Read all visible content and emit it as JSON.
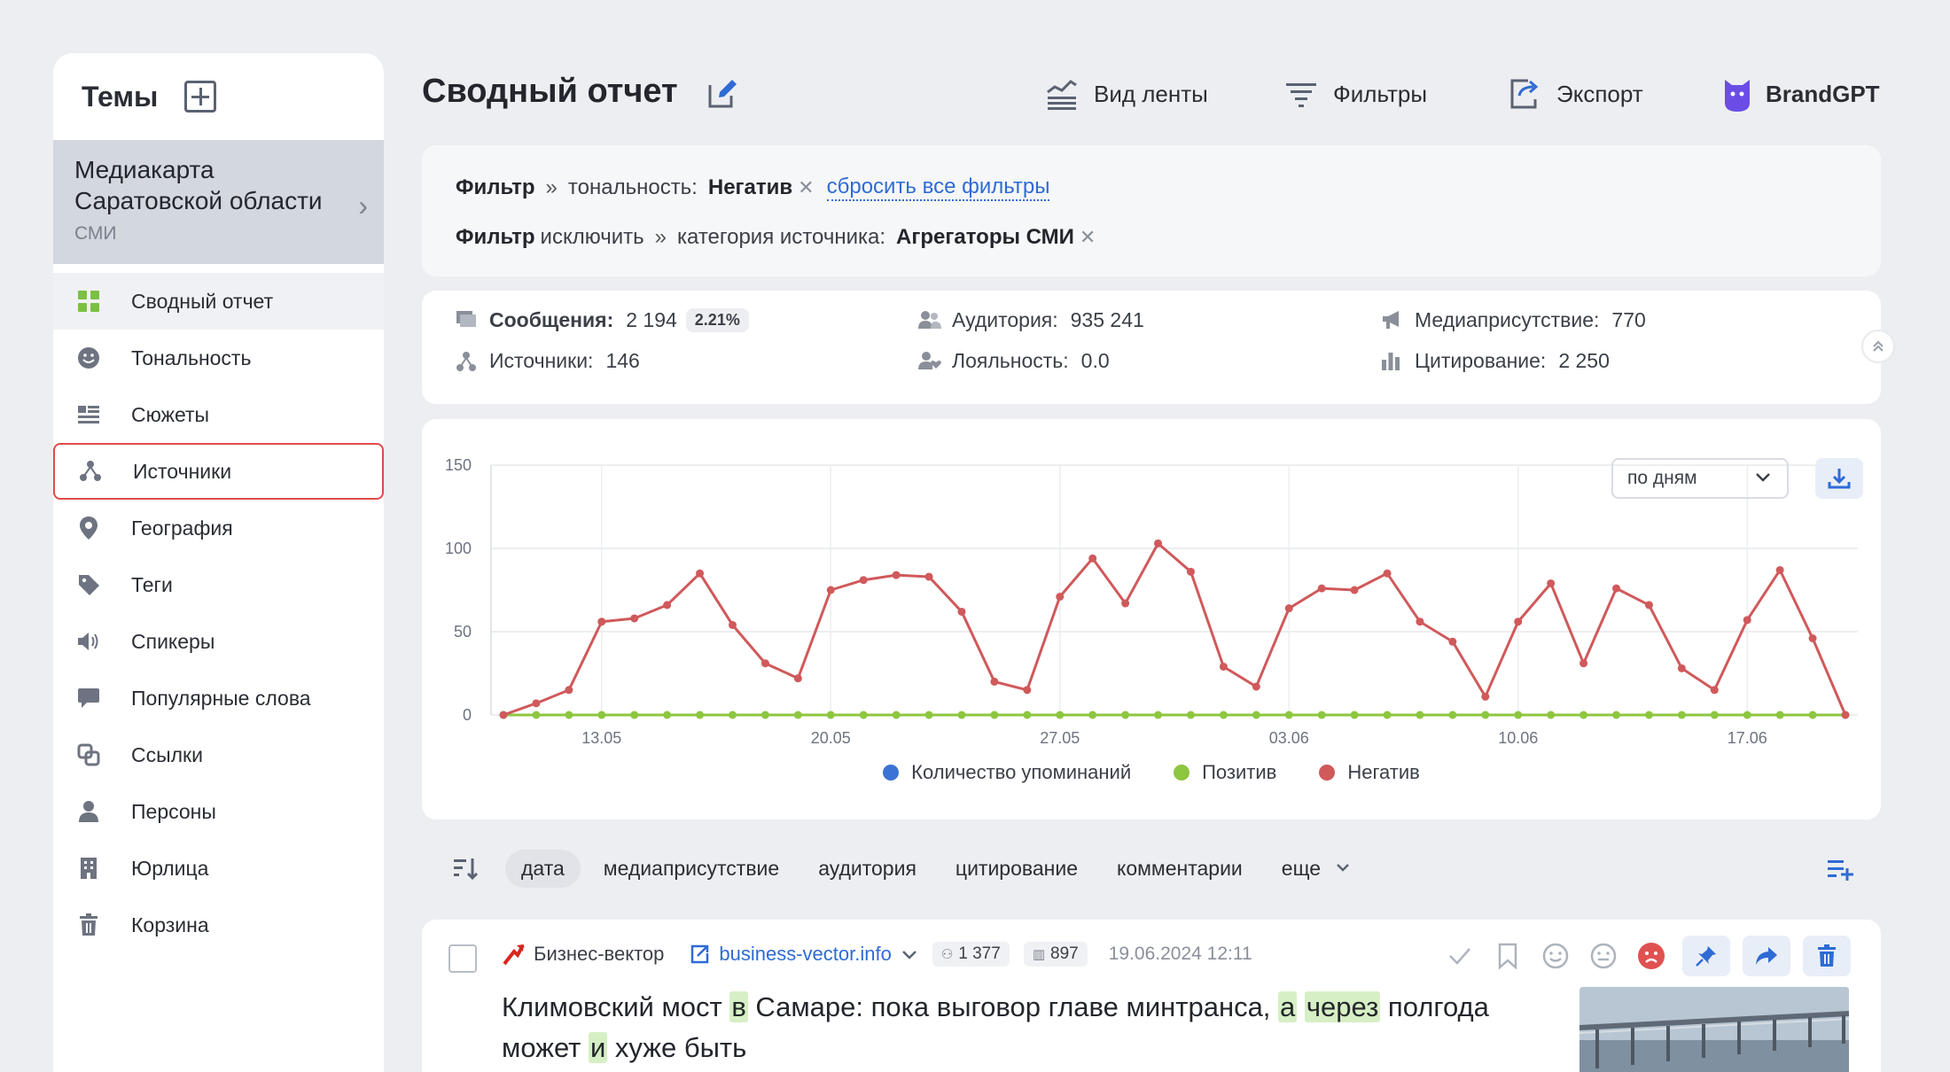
{
  "sidebar": {
    "header_title": "Темы",
    "project": {
      "name": "Медиакарта Саратовской области",
      "type": "СМИ"
    },
    "items": [
      {
        "label": "Сводный отчет",
        "icon": "grid-icon"
      },
      {
        "label": "Тональность",
        "icon": "smile-icon"
      },
      {
        "label": "Сюжеты",
        "icon": "news-icon"
      },
      {
        "label": "Источники",
        "icon": "nodes-icon"
      },
      {
        "label": "География",
        "icon": "location-pin-icon"
      },
      {
        "label": "Теги",
        "icon": "tag-icon"
      },
      {
        "label": "Спикеры",
        "icon": "speaker-icon"
      },
      {
        "label": "Популярные слова",
        "icon": "chat-bubble-icon"
      },
      {
        "label": "Ссылки",
        "icon": "link-icon"
      },
      {
        "label": "Персоны",
        "icon": "person-icon"
      },
      {
        "label": "Юрлица",
        "icon": "building-icon"
      },
      {
        "label": "Корзина",
        "icon": "trash-icon"
      }
    ]
  },
  "header": {
    "title": "Сводный отчет",
    "toolbar": {
      "feed_view": "Вид ленты",
      "filters": "Фильтры",
      "export": "Экспорт",
      "brandgpt": "BrandGPT"
    }
  },
  "filters": {
    "line1": {
      "prefix": "Фильтр",
      "sep": "»",
      "key": "тональность:",
      "value": "Негатив",
      "reset": "сбросить все фильтры"
    },
    "line2": {
      "prefix": "Фильтр",
      "suffix": "исключить",
      "sep": "»",
      "key": "категория источника:",
      "value": "Агрегаторы СМИ"
    }
  },
  "stats": {
    "messages": {
      "label": "Сообщения:",
      "value": "2 194",
      "badge": "2.21%"
    },
    "sources": {
      "label": "Источники:",
      "value": "146"
    },
    "audience": {
      "label": "Аудитория:",
      "value": "935 241"
    },
    "loyalty": {
      "label": "Лояльность:",
      "value": "0.0"
    },
    "media_presence": {
      "label": "Медиаприсутствие:",
      "value": "770"
    },
    "citation": {
      "label": "Цитирование:",
      "value": "2 250"
    }
  },
  "chart_controls": {
    "period": "по дням"
  },
  "chart_data": {
    "type": "line",
    "x": [
      "10.05",
      "11.05",
      "12.05",
      "13.05",
      "14.05",
      "15.05",
      "16.05",
      "17.05",
      "18.05",
      "19.05",
      "20.05",
      "21.05",
      "22.05",
      "23.05",
      "24.05",
      "25.05",
      "26.05",
      "27.05",
      "28.05",
      "29.05",
      "30.05",
      "31.05",
      "01.06",
      "02.06",
      "03.06",
      "04.06",
      "05.06",
      "06.06",
      "07.06",
      "08.06",
      "09.06",
      "10.06",
      "11.06",
      "12.06",
      "13.06",
      "14.06",
      "15.06",
      "16.06",
      "17.06",
      "18.06",
      "19.06",
      "20.06"
    ],
    "xticks": [
      "13.05",
      "20.05",
      "27.05",
      "03.06",
      "10.06",
      "17.06"
    ],
    "ylim": [
      0,
      150
    ],
    "yticks": [
      0,
      50,
      100,
      150
    ],
    "series": [
      {
        "name": "Количество упоминаний",
        "color": "#3b72d6",
        "values": []
      },
      {
        "name": "Позитив",
        "color": "#8dc63f",
        "values": [
          0,
          0,
          0,
          0,
          0,
          0,
          0,
          0,
          0,
          0,
          0,
          0,
          0,
          0,
          0,
          0,
          0,
          0,
          0,
          0,
          0,
          0,
          0,
          0,
          0,
          0,
          0,
          0,
          0,
          0,
          0,
          0,
          0,
          0,
          0,
          0,
          0,
          0,
          0,
          0,
          0,
          0
        ]
      },
      {
        "name": "Негатив",
        "color": "#d0595b",
        "values": [
          0,
          7,
          15,
          56,
          58,
          66,
          85,
          54,
          31,
          22,
          75,
          81,
          84,
          83,
          62,
          20,
          15,
          71,
          94,
          67,
          103,
          86,
          29,
          17,
          64,
          76,
          75,
          85,
          56,
          44,
          11,
          56,
          79,
          31,
          76,
          66,
          28,
          15,
          57,
          87,
          46,
          0
        ]
      }
    ],
    "grid": true,
    "legend": "bottom"
  },
  "sort": {
    "options": [
      "дата",
      "медиаприсутствие",
      "аудитория",
      "цитирование",
      "комментарии",
      "еще"
    ],
    "active": "дата"
  },
  "post": {
    "source": "Бизнес-вектор",
    "url": "business-vector.info",
    "audience": "1 377",
    "views": "897",
    "date": "19.06.2024 12:11",
    "title_parts": [
      {
        "text": "Климовский мост ",
        "hl": false
      },
      {
        "text": "в",
        "hl": true
      },
      {
        "text": " Самаре: пока выговор главе минтранса, ",
        "hl": false
      },
      {
        "text": "а",
        "hl": true
      },
      {
        "text": " ",
        "hl": false
      },
      {
        "text": "через",
        "hl": true
      },
      {
        "text": " полгода может ",
        "hl": false
      },
      {
        "text": "и",
        "hl": true
      },
      {
        "text": " хуже быть",
        "hl": false
      }
    ]
  },
  "colors": {
    "accent": "#2f6bd4",
    "negative": "#d0595b",
    "positive": "#8dc63f",
    "selection_border": "#e04a4a"
  }
}
